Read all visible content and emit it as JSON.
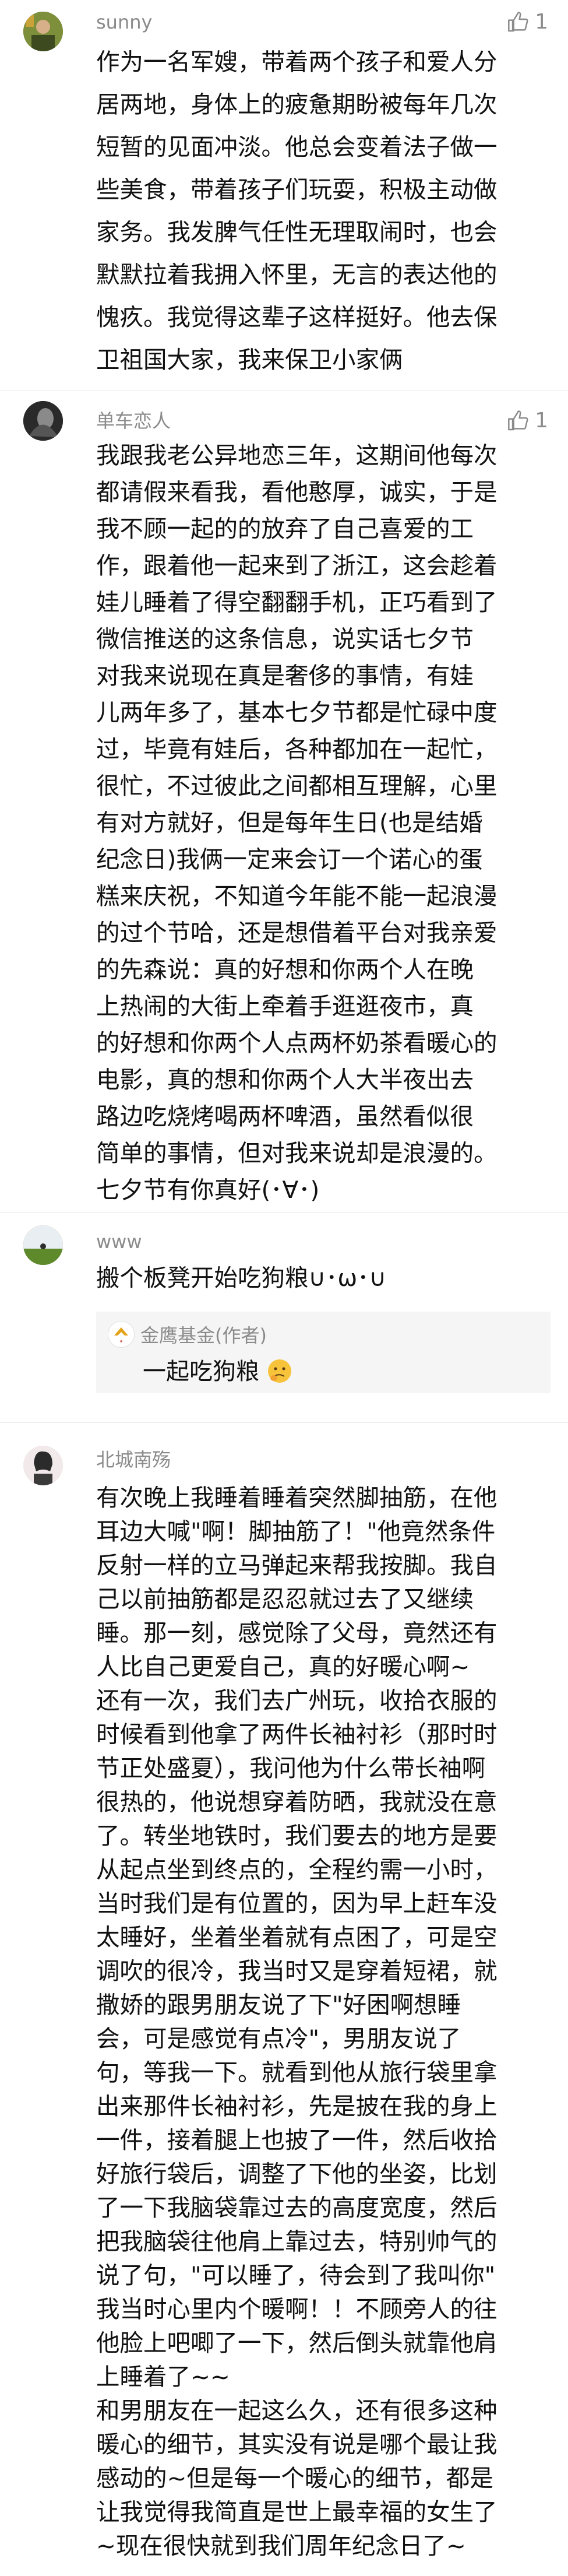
{
  "colors": {
    "username": "#8b8b8b",
    "text": "#111111",
    "divider": "#e6e6e6",
    "reply_bg": "#f5f5f5"
  },
  "comments": [
    {
      "username": "sunny",
      "likes": "1",
      "lines": [
        "作为一名军嫂，带着两个孩子和爱人分",
        "居两地，身体上的疲惫期盼被每年几次",
        "短暂的见面冲淡。他总会变着法子做一",
        "些美食，带着孩子们玩耍，积极主动做",
        "家务。我发脾气任性无理取闹时，也会",
        "默默拉着我拥入怀里，无言的表达他的",
        "愧疚。我觉得这辈子这样挺好。他去保",
        "卫祖国大家，我来保卫小家俩"
      ]
    },
    {
      "username": "单车恋人",
      "likes": "1",
      "lines": [
        "我跟我老公异地恋三年，这期间他每次",
        "都请假来看我，看他憨厚，诚实，于是",
        "我不顾一起的的放弃了自己喜爱的工",
        "作，跟着他一起来到了浙江，这会趁着",
        "娃儿睡着了得空翻翻手机，正巧看到了",
        "微信推送的这条信息，说实话七夕节",
        "对我来说现在真是奢侈的事情，有娃",
        "儿两年多了，基本七夕节都是忙碌中度",
        "过，毕竟有娃后，各种都加在一起忙，",
        "很忙，不过彼此之间都相互理解，心里",
        "有对方就好，但是每年生日(也是结婚",
        "纪念日)我俩一定来会订一个诺心的蛋",
        "糕来庆祝，不知道今年能不能一起浪漫",
        "的过个节哈，还是想借着平台对我亲爱",
        "的先森说：真的好想和你两个人在晚",
        "上热闹的大街上牵着手逛逛夜市，真",
        "的好想和你两个人点两杯奶茶看暖心的",
        "电影，真的想和你两个人大半夜出去",
        "路边吃烧烤喝两杯啤酒，虽然看似很",
        "简单的事情，但对我来说却是浪漫的。",
        "七夕节有你真好(･∀･)"
      ]
    },
    {
      "username": "www",
      "lines": [
        "搬个板凳开始吃狗粮∪･ω･∪"
      ],
      "reply": {
        "author": "金鹰基金(作者)",
        "text": "一起吃狗粮"
      }
    },
    {
      "username": "北城南殇",
      "lines": [
        "有次晚上我睡着睡着突然脚抽筋，在他",
        "耳边大喊\"啊！脚抽筋了！\"他竟然条件",
        "反射一样的立马弹起来帮我按脚。我自",
        "己以前抽筋都是忍忍就过去了又继续",
        "睡。那一刻，感觉除了父母，竟然还有",
        "人比自己更爱自己，真的好暖心啊~",
        "还有一次，我们去广州玩，收拾衣服的",
        "时候看到他拿了两件长袖衬衫（那时时",
        "节正处盛夏），我问他为什么带长袖啊",
        "很热的，他说想穿着防晒，我就没在意",
        "了。转坐地铁时，我们要去的地方是要",
        "从起点坐到终点的，全程约需一小时，",
        "当时我们是有位置的，因为早上赶车没",
        "太睡好，坐着坐着就有点困了，可是空",
        "调吹的很冷，我当时又是穿着短裙，就",
        "撒娇的跟男朋友说了下\"好困啊想睡",
        "会，可是感觉有点冷\"，男朋友说了",
        "句，等我一下。就看到他从旅行袋里拿",
        "出来那件长袖衬衫，先是披在我的身上",
        "一件，接着腿上也披了一件，然后收拾",
        "好旅行袋后，调整了下他的坐姿，比划",
        "了一下我脑袋靠过去的高度宽度，然后",
        "把我脑袋往他肩上靠过去，特别帅气的",
        "说了句，\"可以睡了，待会到了我叫你\"",
        "我当时心里内个暖啊！！不顾旁人的往",
        "他脸上吧唧了一下，然后倒头就靠他肩",
        "上睡着了~~",
        "和男朋友在一起这么久，还有很多这种",
        "暖心的细节，其实没有说是哪个最让我",
        "感动的~但是每一个暖心的细节，都是",
        "让我觉得我简直是世上最幸福的女生了",
        "~现在很快就到我们周年纪念日了~"
      ]
    }
  ]
}
